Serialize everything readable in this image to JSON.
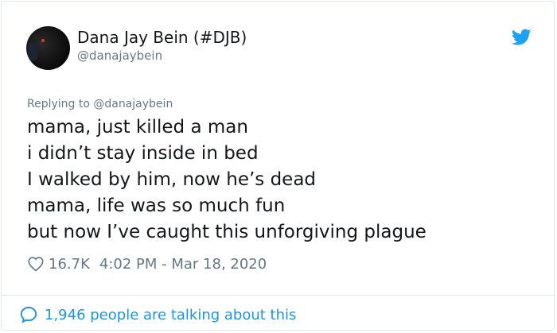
{
  "tweet": {
    "author": {
      "display_name": "Dana Jay Bein (#DJB)",
      "handle": "@danajaybein",
      "avatar_icon": "profile-photo"
    },
    "brand_icon": "twitter-bird-icon",
    "brand_color": "#1da1f2",
    "reply_context": "Replying to @danajaybein",
    "lines": [
      "mama, just killed a man",
      "i didn’t stay inside in bed",
      "I walked by him, now he’s dead",
      "mama, life was so much fun",
      "but now I’ve caught this unforgiving plague"
    ],
    "likes": "16.7K",
    "timestamp": "4:02 PM - Mar 18, 2020",
    "like_icon": "heart-icon"
  },
  "footer": {
    "talking_text": "1,946 people are talking about this",
    "talking_icon": "comment-bubble-icon",
    "link_color": "#1b95e0"
  }
}
